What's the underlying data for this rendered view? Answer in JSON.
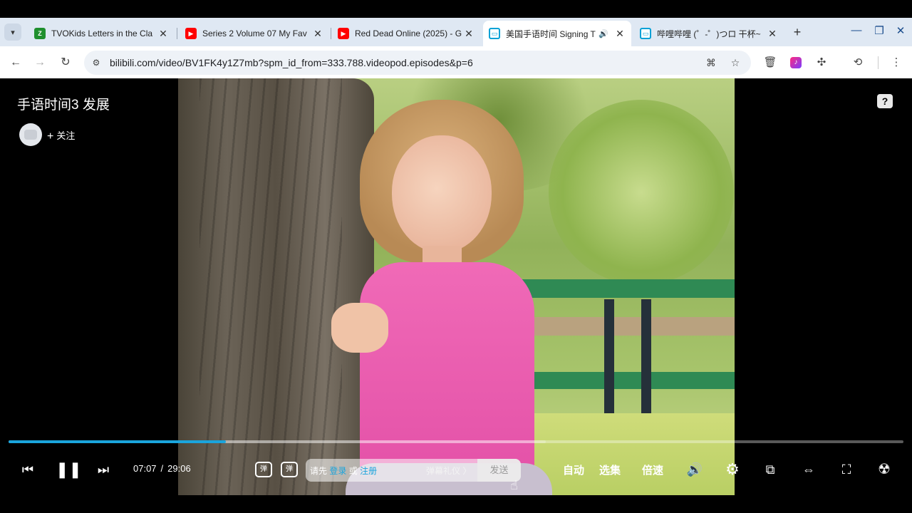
{
  "browser": {
    "tabs": [
      {
        "title": "TVOKids Letters in the Cla",
        "favicon": "tvokids-icon",
        "color": "#2dbb3a"
      },
      {
        "title": "Series 2 Volume 07 My Fav",
        "favicon": "youtube-icon",
        "color": "#ff0000"
      },
      {
        "title": "Red Dead Online (2025) - G",
        "favicon": "youtube-icon",
        "color": "#ff0000"
      },
      {
        "title": "美国手语时间 Signing T",
        "favicon": "bilibili-icon",
        "color": "#00a1d6",
        "active": true
      },
      {
        "title": "哔哩哔哩 (゜-゜)つロ 干杯~",
        "favicon": "bilibili-icon",
        "color": "#00a1d6"
      }
    ],
    "url": "bilibili.com/video/BV1FK4y1Z7mb?spm_id_from=333.788.videopod.episodes&p=6"
  },
  "video": {
    "title": "手语时间3 发展",
    "follow_label": "关注",
    "help_label": "?",
    "current_time": "07:07",
    "total_time": "29:06",
    "progress": 0.243,
    "buffered": 0.6,
    "accent": "#1aa4dc"
  },
  "danmaku": {
    "hint_prefix": "请先",
    "login": "登录",
    "or": "或",
    "register": "注册",
    "etiquette": "弹幕礼仪 〉",
    "send": "发送",
    "toggle_label": "弹",
    "settings_label": "弹"
  },
  "controls": {
    "auto": "自动",
    "episodes": "选集",
    "speed": "倍速"
  }
}
